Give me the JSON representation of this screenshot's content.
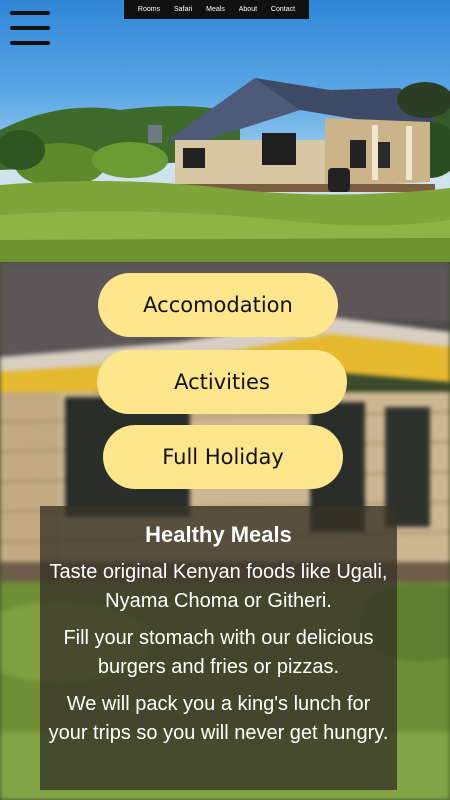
{
  "nav": {
    "links": [
      "Rooms",
      "Safari",
      "Meals",
      "About",
      "Contact"
    ]
  },
  "icons": {
    "menu": "hamburger-menu-icon"
  },
  "buttons": {
    "accommodation": "Accomodation",
    "activities": "Activities",
    "full_holiday": "Full Holiday"
  },
  "meals_card": {
    "title": "Healthy Meals",
    "paragraphs": [
      "Taste original Kenyan foods like Ugali, Nyama Choma or Githeri.",
      "Fill your stomach with our delicious burgers and fries or pizzas.",
      "We will pack you a king's lunch for your trips so you will never get hungry."
    ]
  },
  "colors": {
    "pill": "#fde68b",
    "nav_bg": "#111111",
    "card_bg": "rgba(55,50,38,0.78)"
  }
}
